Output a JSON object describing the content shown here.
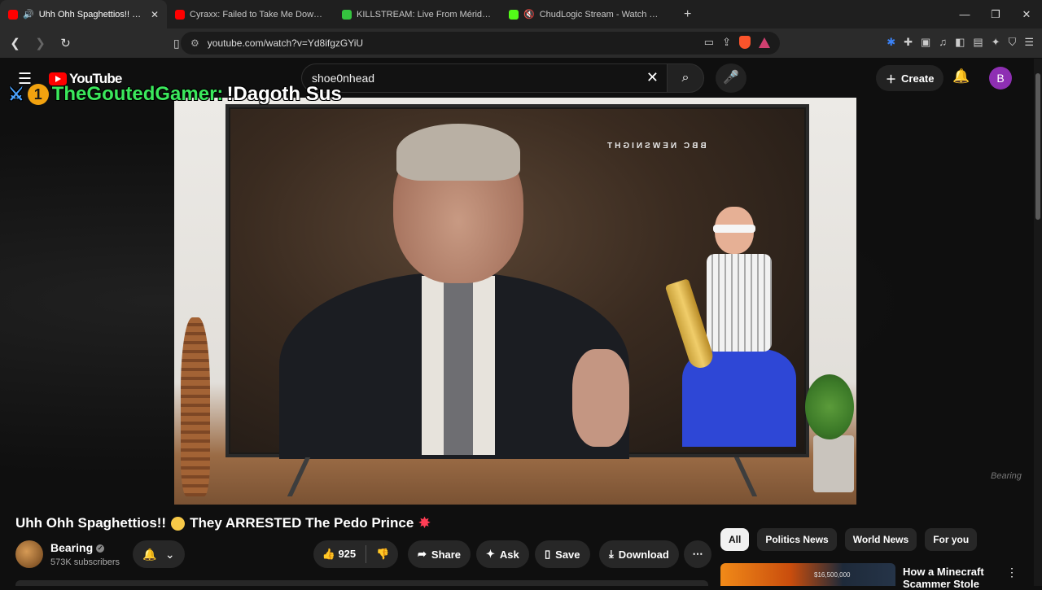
{
  "browser": {
    "tabs": [
      {
        "title": "Uhh Ohh Spaghettios!! 😳 Th",
        "favicon_color": "#ff0000",
        "active": true,
        "audio": "🔊"
      },
      {
        "title": "Cyraxx: Failed to Take Me Down! | Lol",
        "favicon_color": "#ff0000",
        "active": false
      },
      {
        "title": "KILLSTREAM: Live From Mérida, Mex",
        "favicon_color": "#35c43f",
        "active": false
      },
      {
        "title": "ChudLogic Stream - Watch Live o",
        "favicon_color": "#53fc18",
        "active": false,
        "audio": "🔇"
      }
    ],
    "new_tab": "+",
    "url": "youtube.com/watch?v=Yd8ifgzGYiU"
  },
  "youtube": {
    "logo_text": "YouTube",
    "search_value": "shoe0nhead",
    "create_label": "Create",
    "account_initial": "B"
  },
  "chat_overlay": {
    "badge": "1",
    "username": "TheGoutedGamer:",
    "message": "!Dagoth Sus"
  },
  "video": {
    "broadcaster_mark": "BBC NEWSNIGHT",
    "watermark": "Bearing"
  },
  "details": {
    "title": "Uhh Ohh Spaghettios!!",
    "title_rest": "They ARRESTED The Pedo Prince",
    "channel": "Bearing",
    "subscribers": "573K subscribers",
    "likes": "925",
    "share": "Share",
    "ask": "Ask",
    "save": "Save",
    "download": "Download"
  },
  "chips": [
    "All",
    "Politics News",
    "World News",
    "For you"
  ],
  "recommendation": {
    "title": "How a Minecraft Scammer Stole",
    "thumb_price": "$16,500,000"
  }
}
